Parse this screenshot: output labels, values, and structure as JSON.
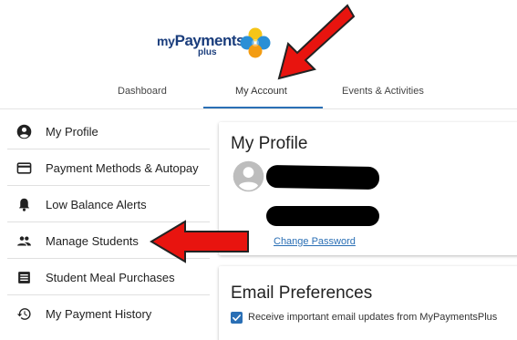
{
  "brand": {
    "logo_my": "my",
    "logo_payments": "Payments",
    "logo_plus": "plus",
    "colors": {
      "navy": "#1a3d7c",
      "yellow": "#f5c518",
      "blue": "#2a8fd6",
      "orange": "#f39c12"
    }
  },
  "nav": {
    "tabs": [
      {
        "label": "Dashboard"
      },
      {
        "label": "My Account",
        "active": true
      },
      {
        "label": "Events & Activities"
      }
    ],
    "active_color": "#2a6fb5"
  },
  "sidebar": {
    "items": [
      {
        "label": "My Profile",
        "icon": "account-circle-icon"
      },
      {
        "label": "Payment Methods & Autopay",
        "icon": "credit-card-icon"
      },
      {
        "label": "Low Balance Alerts",
        "icon": "bell-icon"
      },
      {
        "label": "Manage Students",
        "icon": "people-icon"
      },
      {
        "label": "Student Meal Purchases",
        "icon": "receipt-list-icon"
      },
      {
        "label": "My Payment History",
        "icon": "history-icon"
      }
    ]
  },
  "profile": {
    "title": "My Profile",
    "change_password": "Change Password"
  },
  "email_prefs": {
    "title": "Email Preferences",
    "checkbox_label": "Receive important email updates from MyPaymentsPlus",
    "checked": true
  },
  "annotations": {
    "arrow_color": "#e8140f",
    "arrows": [
      "arrow-to-my-account",
      "arrow-to-manage-students"
    ]
  }
}
